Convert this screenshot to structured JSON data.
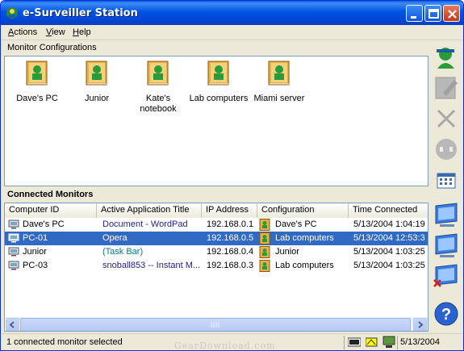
{
  "window": {
    "title": "e-Surveiller Station"
  },
  "menu": [
    "Actions",
    "View",
    "Help"
  ],
  "menu_underline": [
    "A",
    "V",
    "H"
  ],
  "menu_rest": [
    "ctions",
    "iew",
    "elp"
  ],
  "configs_section": {
    "label": "Monitor Configurations"
  },
  "configurations": [
    {
      "label": "Dave's PC"
    },
    {
      "label": "Junior"
    },
    {
      "label": "Kate's notebook"
    },
    {
      "label": "Lab computers"
    },
    {
      "label": "Miami server"
    }
  ],
  "monitors_section": {
    "label": "Connected Monitors"
  },
  "table": {
    "columns": [
      "Computer ID",
      "Active Application Title",
      "IP Address",
      "Configuration",
      "Time Connected"
    ],
    "rows": [
      {
        "id": "Dave's PC",
        "app": "Document - WordPad",
        "ip": "192.168.0.1",
        "config": "Dave's PC",
        "time": "5/13/2004 1:04:19",
        "selected": false,
        "app_style": "blue"
      },
      {
        "id": "PC-01",
        "app": "Opera",
        "ip": "192.168.0.5",
        "config": "Lab computers",
        "time": "5/13/2004 12:53:3",
        "selected": true,
        "app_style": "blue"
      },
      {
        "id": "Junior",
        "app": "(Task Bar)",
        "ip": "192.168.0.4",
        "config": "Junior",
        "time": "5/13/2004 1:03:25",
        "selected": false,
        "app_style": "teal"
      },
      {
        "id": "PC-03",
        "app": "snoball853 -- Instant M...",
        "ip": "192.168.0.3",
        "config": "Lab computers",
        "time": "5/13/2004 1:03:25",
        "selected": false,
        "app_style": "blue"
      }
    ]
  },
  "status": {
    "text": "1 connected monitor selected",
    "date": "5/13/2004"
  },
  "toolbar_icons": [
    "add-configuration-icon",
    "edit-configuration-icon",
    "delete-icon",
    "disconnect-icon",
    "grid-view-icon",
    "monitor-icon",
    "monitor-view-icon",
    "monitor-disconnect-icon",
    "help-icon"
  ],
  "watermark": "GearDownload.com",
  "colors": {
    "titlebar": "#0053e3",
    "selection": "#316ac5",
    "app_text": "#1e1e99",
    "taskbar_text": "#007d7d"
  }
}
